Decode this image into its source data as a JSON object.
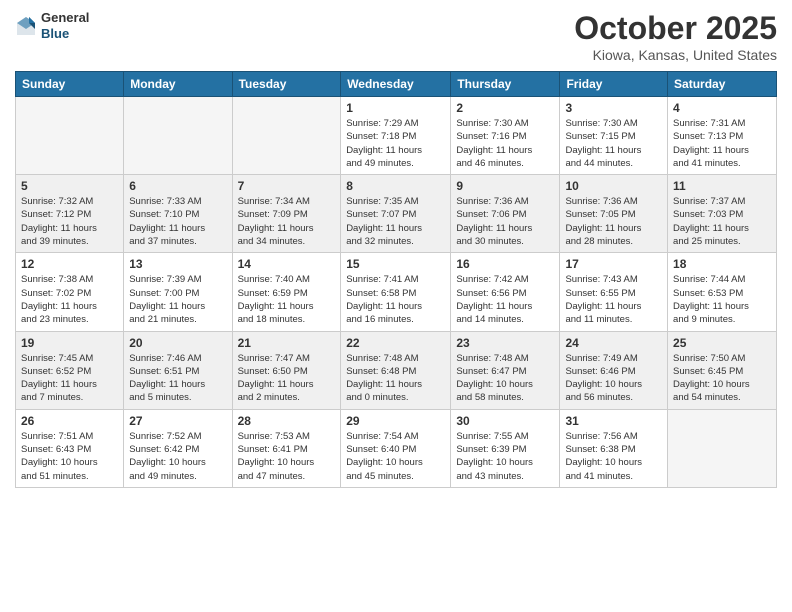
{
  "header": {
    "logo_general": "General",
    "logo_blue": "Blue",
    "month_title": "October 2025",
    "location": "Kiowa, Kansas, United States"
  },
  "weekdays": [
    "Sunday",
    "Monday",
    "Tuesday",
    "Wednesday",
    "Thursday",
    "Friday",
    "Saturday"
  ],
  "weeks": [
    [
      {
        "day": "",
        "info": ""
      },
      {
        "day": "",
        "info": ""
      },
      {
        "day": "",
        "info": ""
      },
      {
        "day": "1",
        "info": "Sunrise: 7:29 AM\nSunset: 7:18 PM\nDaylight: 11 hours\nand 49 minutes."
      },
      {
        "day": "2",
        "info": "Sunrise: 7:30 AM\nSunset: 7:16 PM\nDaylight: 11 hours\nand 46 minutes."
      },
      {
        "day": "3",
        "info": "Sunrise: 7:30 AM\nSunset: 7:15 PM\nDaylight: 11 hours\nand 44 minutes."
      },
      {
        "day": "4",
        "info": "Sunrise: 7:31 AM\nSunset: 7:13 PM\nDaylight: 11 hours\nand 41 minutes."
      }
    ],
    [
      {
        "day": "5",
        "info": "Sunrise: 7:32 AM\nSunset: 7:12 PM\nDaylight: 11 hours\nand 39 minutes."
      },
      {
        "day": "6",
        "info": "Sunrise: 7:33 AM\nSunset: 7:10 PM\nDaylight: 11 hours\nand 37 minutes."
      },
      {
        "day": "7",
        "info": "Sunrise: 7:34 AM\nSunset: 7:09 PM\nDaylight: 11 hours\nand 34 minutes."
      },
      {
        "day": "8",
        "info": "Sunrise: 7:35 AM\nSunset: 7:07 PM\nDaylight: 11 hours\nand 32 minutes."
      },
      {
        "day": "9",
        "info": "Sunrise: 7:36 AM\nSunset: 7:06 PM\nDaylight: 11 hours\nand 30 minutes."
      },
      {
        "day": "10",
        "info": "Sunrise: 7:36 AM\nSunset: 7:05 PM\nDaylight: 11 hours\nand 28 minutes."
      },
      {
        "day": "11",
        "info": "Sunrise: 7:37 AM\nSunset: 7:03 PM\nDaylight: 11 hours\nand 25 minutes."
      }
    ],
    [
      {
        "day": "12",
        "info": "Sunrise: 7:38 AM\nSunset: 7:02 PM\nDaylight: 11 hours\nand 23 minutes."
      },
      {
        "day": "13",
        "info": "Sunrise: 7:39 AM\nSunset: 7:00 PM\nDaylight: 11 hours\nand 21 minutes."
      },
      {
        "day": "14",
        "info": "Sunrise: 7:40 AM\nSunset: 6:59 PM\nDaylight: 11 hours\nand 18 minutes."
      },
      {
        "day": "15",
        "info": "Sunrise: 7:41 AM\nSunset: 6:58 PM\nDaylight: 11 hours\nand 16 minutes."
      },
      {
        "day": "16",
        "info": "Sunrise: 7:42 AM\nSunset: 6:56 PM\nDaylight: 11 hours\nand 14 minutes."
      },
      {
        "day": "17",
        "info": "Sunrise: 7:43 AM\nSunset: 6:55 PM\nDaylight: 11 hours\nand 11 minutes."
      },
      {
        "day": "18",
        "info": "Sunrise: 7:44 AM\nSunset: 6:53 PM\nDaylight: 11 hours\nand 9 minutes."
      }
    ],
    [
      {
        "day": "19",
        "info": "Sunrise: 7:45 AM\nSunset: 6:52 PM\nDaylight: 11 hours\nand 7 minutes."
      },
      {
        "day": "20",
        "info": "Sunrise: 7:46 AM\nSunset: 6:51 PM\nDaylight: 11 hours\nand 5 minutes."
      },
      {
        "day": "21",
        "info": "Sunrise: 7:47 AM\nSunset: 6:50 PM\nDaylight: 11 hours\nand 2 minutes."
      },
      {
        "day": "22",
        "info": "Sunrise: 7:48 AM\nSunset: 6:48 PM\nDaylight: 11 hours\nand 0 minutes."
      },
      {
        "day": "23",
        "info": "Sunrise: 7:48 AM\nSunset: 6:47 PM\nDaylight: 10 hours\nand 58 minutes."
      },
      {
        "day": "24",
        "info": "Sunrise: 7:49 AM\nSunset: 6:46 PM\nDaylight: 10 hours\nand 56 minutes."
      },
      {
        "day": "25",
        "info": "Sunrise: 7:50 AM\nSunset: 6:45 PM\nDaylight: 10 hours\nand 54 minutes."
      }
    ],
    [
      {
        "day": "26",
        "info": "Sunrise: 7:51 AM\nSunset: 6:43 PM\nDaylight: 10 hours\nand 51 minutes."
      },
      {
        "day": "27",
        "info": "Sunrise: 7:52 AM\nSunset: 6:42 PM\nDaylight: 10 hours\nand 49 minutes."
      },
      {
        "day": "28",
        "info": "Sunrise: 7:53 AM\nSunset: 6:41 PM\nDaylight: 10 hours\nand 47 minutes."
      },
      {
        "day": "29",
        "info": "Sunrise: 7:54 AM\nSunset: 6:40 PM\nDaylight: 10 hours\nand 45 minutes."
      },
      {
        "day": "30",
        "info": "Sunrise: 7:55 AM\nSunset: 6:39 PM\nDaylight: 10 hours\nand 43 minutes."
      },
      {
        "day": "31",
        "info": "Sunrise: 7:56 AM\nSunset: 6:38 PM\nDaylight: 10 hours\nand 41 minutes."
      },
      {
        "day": "",
        "info": ""
      }
    ]
  ]
}
